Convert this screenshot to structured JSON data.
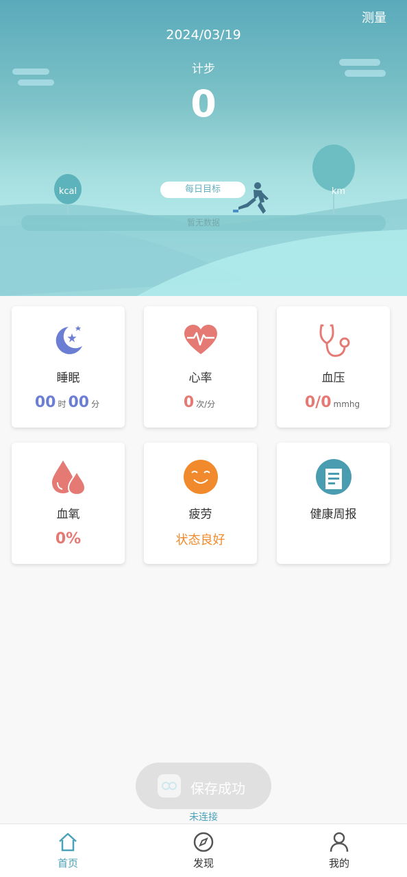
{
  "header": {
    "measure_label": "测量",
    "date": "2024/03/19",
    "steps_label": "计步",
    "steps_value": "0",
    "daily_goal_label": "每日目标",
    "progress_text": "暂无数据",
    "kcal_label": "kcal",
    "km_label": "km"
  },
  "cards": {
    "sleep": {
      "title": "睡眠",
      "hours": "00",
      "hours_unit": "时",
      "minutes": "00",
      "minutes_unit": "分",
      "icon": "moon-star-icon"
    },
    "heart_rate": {
      "title": "心率",
      "value": "0",
      "unit": "次/分",
      "icon": "heart-pulse-icon"
    },
    "blood_pressure": {
      "title": "血压",
      "value": "0/0",
      "unit": "mmhg",
      "icon": "stethoscope-icon"
    },
    "blood_oxygen": {
      "title": "血氧",
      "value": "0%",
      "icon": "blood-drops-icon"
    },
    "fatigue": {
      "title": "疲劳",
      "status": "状态良好",
      "icon": "smile-face-icon"
    },
    "weekly_report": {
      "title": "健康周报",
      "icon": "report-document-icon"
    }
  },
  "toast": {
    "text": "保存成功"
  },
  "connection_status": "未连接",
  "nav": {
    "items": [
      {
        "label": "首页",
        "icon": "home-icon",
        "active": true
      },
      {
        "label": "发现",
        "icon": "compass-icon",
        "active": false
      },
      {
        "label": "我的",
        "icon": "user-icon",
        "active": false
      }
    ]
  },
  "colors": {
    "accent": "#4ba1b7",
    "sleep_blue": "#6b7ed4",
    "health_red": "#e57a74",
    "fatigue_orange": "#f08a2c",
    "report_teal": "#4a9db1"
  }
}
